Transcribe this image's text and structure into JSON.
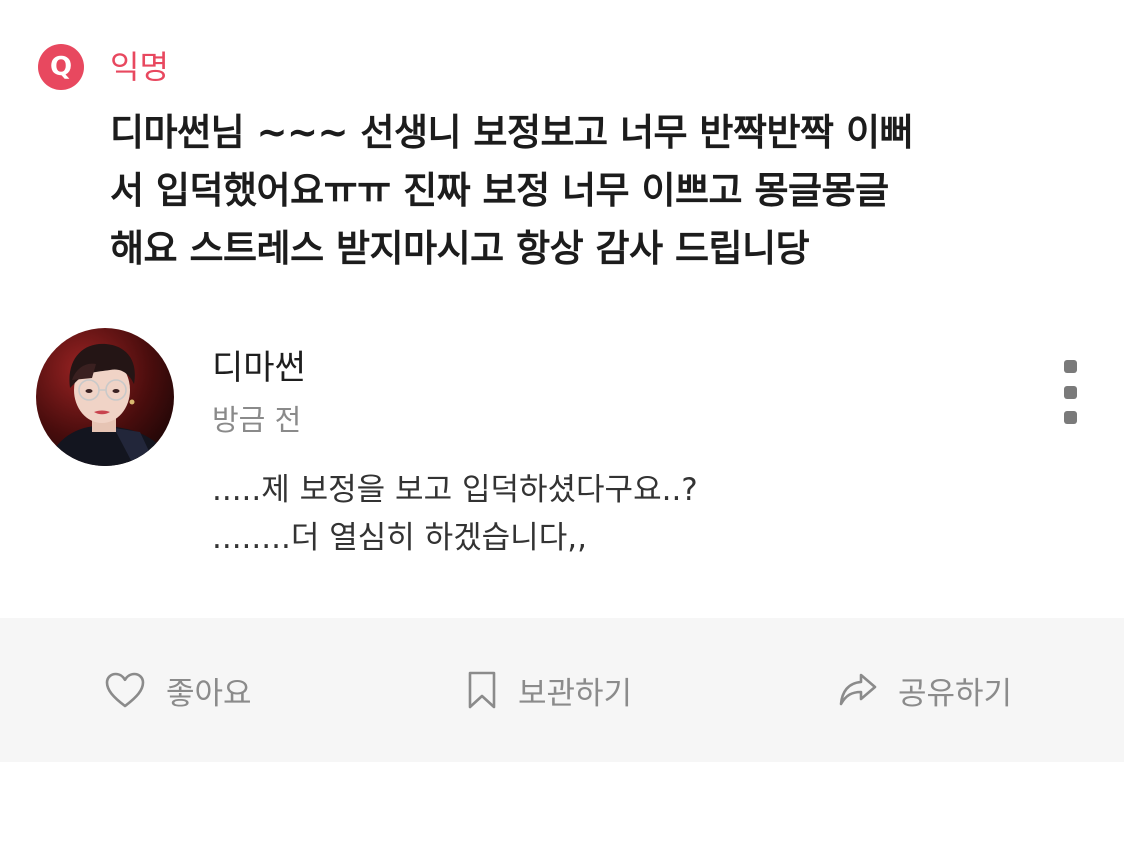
{
  "question": {
    "badge_letter": "Q",
    "asker": "익명",
    "text_lines": [
      "디마썬님 ~~~ 선생니 보정보고 너무 반짝반짝 이뻐",
      "서 입덕했어요ㅠㅠ 진짜 보정 너무 이쁘고 몽글몽글",
      "해요 스트레스 받지마시고 항상 감사 드립니당"
    ]
  },
  "answer": {
    "author_name": "디마썬",
    "time": "방금 전",
    "lines": [
      ".....제 보정을 보고 입덕하셨다구요..?",
      "........더 열심히 하겠습니다,,"
    ]
  },
  "actions": {
    "like_label": "좋아요",
    "save_label": "보관하기",
    "share_label": "공유하기"
  },
  "colors": {
    "accent": "#e8485f",
    "icon_gray": "#8b8b8b",
    "bar_background": "#f6f6f6"
  },
  "icons": {
    "badge": "q-badge-icon",
    "more": "more-vertical-icon",
    "like": "heart-icon",
    "save": "bookmark-icon",
    "share": "share-arrow-icon"
  }
}
